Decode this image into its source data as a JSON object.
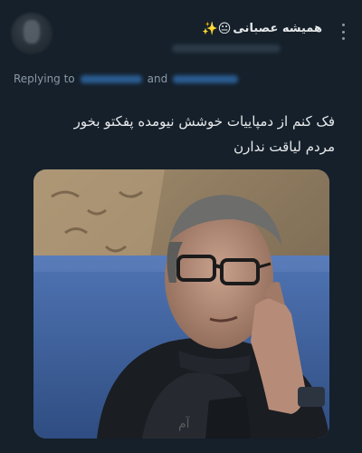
{
  "tweet": {
    "display_name": "همیشه عصبانی",
    "name_emojis": "😐✨",
    "replying_prefix": "Replying to",
    "replying_and": "and",
    "text_line_1": "فک کنم از دمپاییات خوشش نیومده پفکتو بخور",
    "text_line_2": "مردم لیاقت ندارن"
  },
  "icons": {
    "more": "more-vertical-icon",
    "avatar": "avatar"
  },
  "colors": {
    "background": "#15202b",
    "text": "#e7e9ea",
    "muted": "#8b98a5",
    "mention": "#1d9bf0"
  }
}
